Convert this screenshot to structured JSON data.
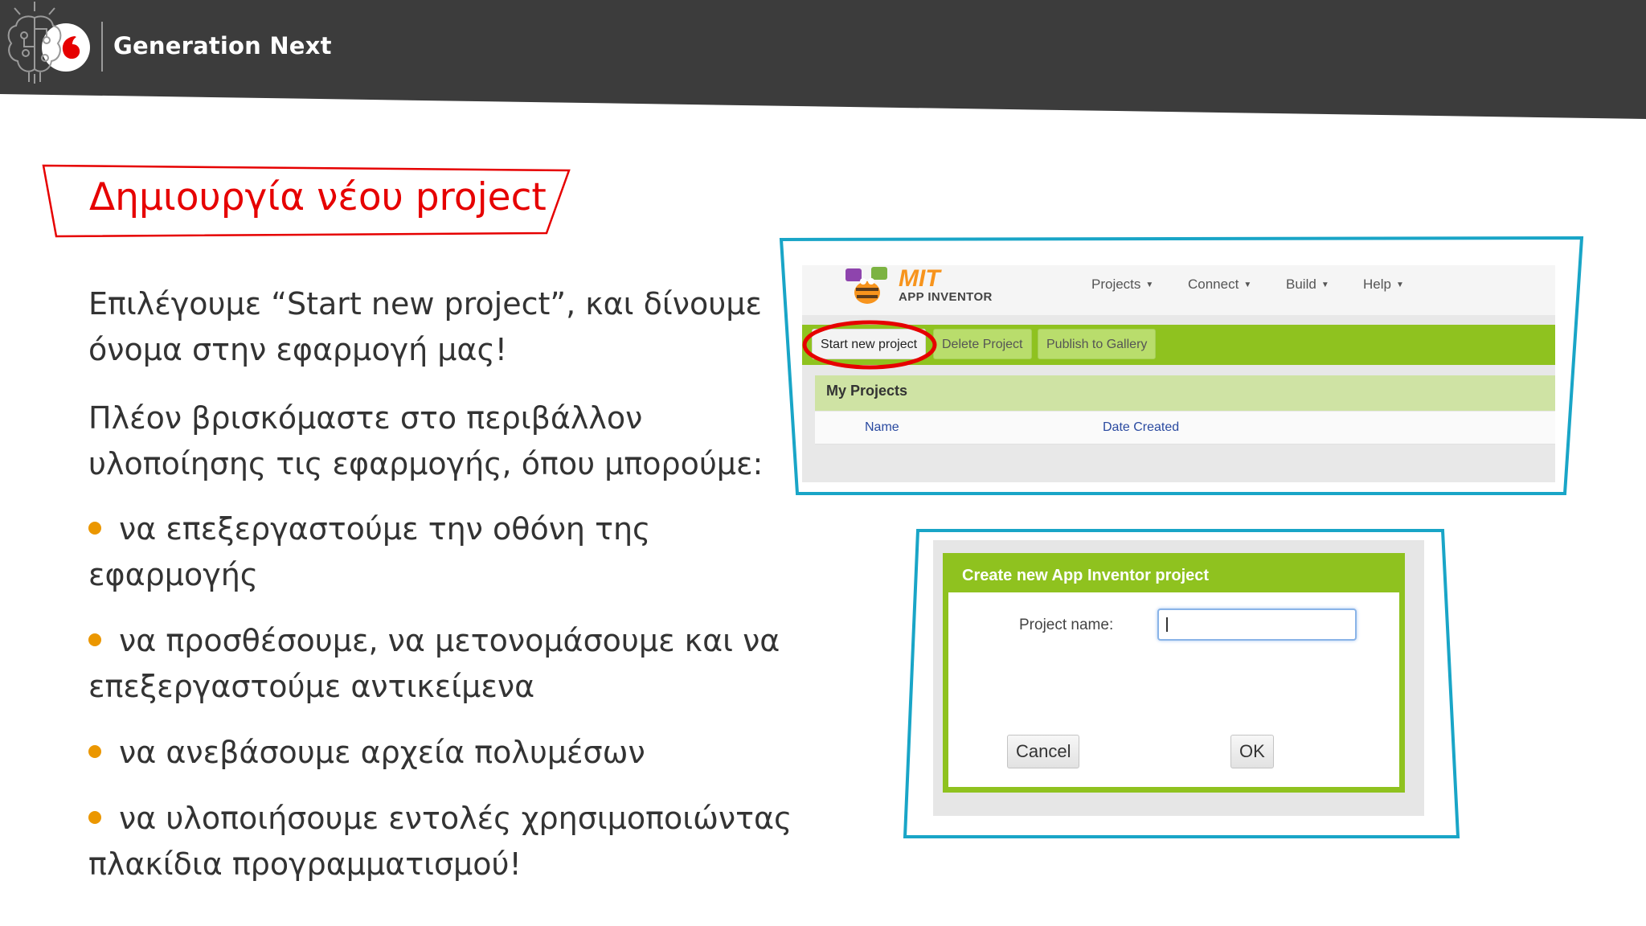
{
  "header": {
    "brand": "Generation Next",
    "logo_icon": "vodafone-logo",
    "brain_icon": "brain-icon"
  },
  "colors": {
    "header_bg": "#3c3c3c",
    "accent_red": "#e60000",
    "bullet_orange": "#eb9700",
    "frame_blue": "#19a5c7",
    "ai_green": "#8fc21f"
  },
  "slide": {
    "title": "Δημιουργία νέου project",
    "para1_line1": "Επιλέγουμε “Start new project”, και δίνουμε",
    "para1_line2": "όνομα στην εφαρμογή μας!",
    "para2_line1": "Πλέον βρισκόμαστε στο περιβάλλον",
    "para2_line2": "υλοποίησης τις εφαρμογής, όπου μπορούμε:",
    "bullets": [
      {
        "line1": "να επεξεργαστούμε την οθόνη της",
        "line2": "εφαρμογής"
      },
      {
        "line1": "να προσθέσουμε, να μετονομάσουμε και να",
        "line2": "επεξεργαστούμε αντικείμενα"
      },
      {
        "line1": "να ανεβάσουμε αρχεία πολυμέσων",
        "line2": ""
      },
      {
        "line1": "να υλοποιήσουμε εντολές χρησιμοποιώντας",
        "line2": "πλακίδια προγραμματισμού!"
      }
    ]
  },
  "app_inventor": {
    "logo_title": "MIT",
    "logo_subtitle": "APP INVENTOR",
    "nav": [
      "Projects",
      "Connect",
      "Build",
      "Help"
    ],
    "toolbar": {
      "start": "Start new project",
      "delete": "Delete Project",
      "publish": "Publish to Gallery"
    },
    "section_title": "My Projects",
    "columns": [
      "Name",
      "Date Created"
    ]
  },
  "dialog": {
    "title": "Create new App Inventor project",
    "label": "Project name:",
    "input_value": "",
    "cancel": "Cancel",
    "ok": "OK"
  }
}
